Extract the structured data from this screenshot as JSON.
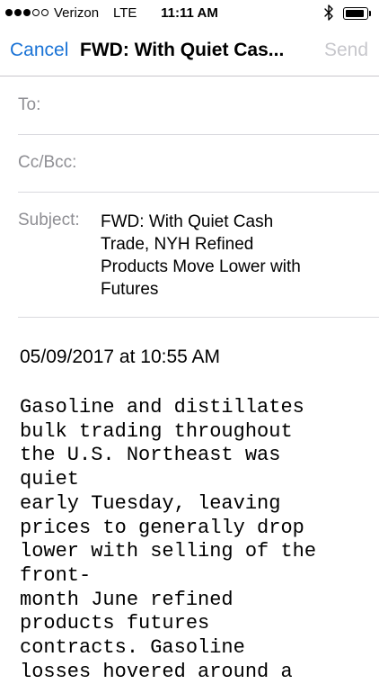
{
  "status_bar": {
    "carrier": "Verizon",
    "network": "LTE",
    "time": "11:11 AM",
    "signal_bars_filled": 3,
    "signal_bars_total": 5,
    "battery_level": 0.9,
    "bluetooth_icon": "bluetooth-icon",
    "battery_icon": "battery-icon"
  },
  "nav": {
    "cancel_label": "Cancel",
    "title": "FWD: With Quiet Cas...",
    "send_label": "Send",
    "accent_color": "#1a73d6",
    "disabled_color": "#c7c7cc"
  },
  "compose": {
    "to_label": "To:",
    "cc_label": "Cc/Bcc:",
    "subject_label": "Subject:",
    "subject_value": "FWD: With Quiet Cash Trade, NYH Refined Products Move Lower with Futures"
  },
  "message": {
    "date_line": "05/09/2017 at 10:55 AM",
    "body": "Gasoline and distillates\nbulk trading throughout\nthe U.S. Northeast was\nquiet\nearly Tuesday, leaving\nprices to generally drop\nlower with selling of the\nfront-\nmonth June refined\nproducts futures\ncontracts. Gasoline\nlosses hovered around a"
  }
}
